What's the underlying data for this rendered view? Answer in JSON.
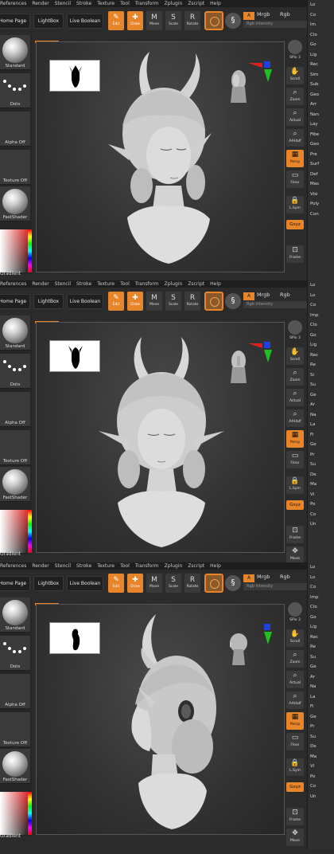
{
  "menu": [
    "References",
    "Render",
    "Stencil",
    "Stroke",
    "Texture",
    "Tool",
    "Transform",
    "Zplugin",
    "Zscript",
    "Help"
  ],
  "toolbar": {
    "home_page": "Home Page",
    "lightbox": "LightBox",
    "live_boolean": "Live Boolean",
    "edit": "Edit",
    "draw": "Draw",
    "move": "Move",
    "scale": "Scale",
    "rotate": "Rotate",
    "a_label": "A",
    "mrgb": "Mrgb",
    "rgb": "Rgb",
    "rgb_intensity": "Rgb Intensity"
  },
  "left_tray": {
    "standard": "Standard",
    "dots": "Dots",
    "alpha_off": "Alpha Off",
    "texture_off": "Texture Off",
    "fastshader": "FastShader",
    "gradient": "Gradient"
  },
  "right_shelf": {
    "spix": "SPix 3",
    "scroll": "Scroll",
    "zoom": "Zoom",
    "actual": "Actual",
    "aahalf": "AAHalf",
    "persp": "Persp",
    "floor": "Floor",
    "lsym": "L.Sym",
    "gxyz": "Gxyz",
    "frame": "Frame",
    "move": "Move"
  },
  "far_right": {
    "panel1": [
      "Lo",
      "Co",
      "Im",
      "Clo",
      "Go",
      "Lig",
      "Rec",
      "Sim",
      "Sub",
      "Geo",
      "Arr",
      "Nan",
      "Lay",
      "Fibe",
      "Geo",
      "Pre",
      "Surf",
      "Def",
      "Mas",
      "Visi",
      "Poly",
      "Con"
    ],
    "panel2": [
      "Lo",
      "Lo",
      "Co",
      "Imp",
      "Clo",
      "Go",
      "Lig",
      "Rec",
      "Re",
      "Si",
      "Su",
      "Ge",
      "Ar",
      "Na",
      "La",
      "Fi",
      "Ge",
      "Pr",
      "Su",
      "De",
      "Ma",
      "Vi",
      "Po",
      "Co",
      "Un"
    ],
    "panel3": [
      "Lo",
      "Lo",
      "Co",
      "Imp",
      "Clo",
      "Go",
      "Lig",
      "Rec",
      "Re",
      "Su",
      "Ge",
      "Ar",
      "Na",
      "La",
      "Fi",
      "Ge",
      "Pr",
      "Su",
      "De",
      "Ma",
      "Vi",
      "Po",
      "Co",
      "Un"
    ]
  },
  "colors": {
    "accent": "#e8852a",
    "axis_red": "#e02020",
    "axis_green": "#20c020",
    "axis_blue": "#2040e0",
    "sculpt": "#d6d6d6"
  },
  "views": [
    "front-three-quarter",
    "front",
    "side"
  ]
}
